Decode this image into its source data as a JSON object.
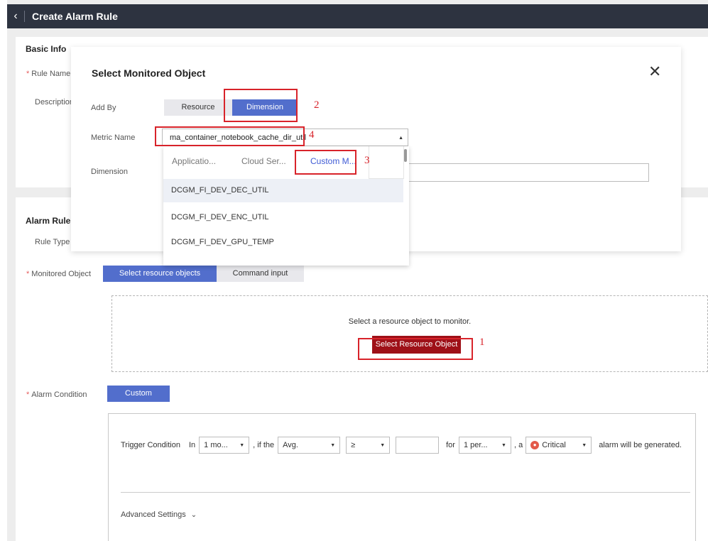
{
  "header": {
    "back_icon": "chevron-left-icon",
    "title": "Create Alarm Rule"
  },
  "basic_info": {
    "section_title": "Basic Info",
    "rule_name_label": "Rule Name",
    "description_label": "Description"
  },
  "alarm_rule": {
    "section_title": "Alarm Rule",
    "rule_type_label": "Rule Type",
    "monitored_object": {
      "label": "Monitored Object",
      "tabs": [
        "Select resource objects",
        "Command input"
      ],
      "selected_tab": "Select resource objects",
      "hint": "Select a resource object to monitor.",
      "button": "Select Resource Object"
    },
    "alarm_condition": {
      "label": "Alarm Condition",
      "mode": "Custom",
      "trigger_label": "Trigger Condition",
      "in_text": "In",
      "period_value": "1 mo...",
      "if_text": ", if the",
      "stat_value": "Avg.",
      "operator_value": "≥",
      "threshold_value": "",
      "for_text": "for",
      "count_value": "1 per...",
      "a_text": ", a",
      "severity_value": "Critical",
      "end_text": "alarm will be generated.",
      "advanced_label": "Advanced Settings"
    }
  },
  "modal": {
    "title": "Select Monitored Object",
    "close_icon": "close-icon",
    "add_by_label": "Add By",
    "add_by_options": [
      "Resource",
      "Dimension"
    ],
    "add_by_selected": "Dimension",
    "metric_label": "Metric Name",
    "metric_value": "ma_container_notebook_cache_dir_util",
    "dimension_label": "Dimension",
    "dimension_value": ""
  },
  "dropdown": {
    "tabs": [
      "Applicatio...",
      "Cloud Ser...",
      "Custom M..."
    ],
    "active_tab": "Custom M...",
    "items": [
      "DCGM_FI_DEV_DEC_UTIL",
      "DCGM_FI_DEV_ENC_UTIL",
      "DCGM_FI_DEV_GPU_TEMP"
    ],
    "highlighted_item": "DCGM_FI_DEV_DEC_UTIL"
  },
  "annotations": [
    "1",
    "2",
    "3",
    "4"
  ],
  "colors": {
    "topbar": "#2d3340",
    "primary": "#526ecc",
    "danger": "#9e1018",
    "highlight": "#d8232a"
  }
}
